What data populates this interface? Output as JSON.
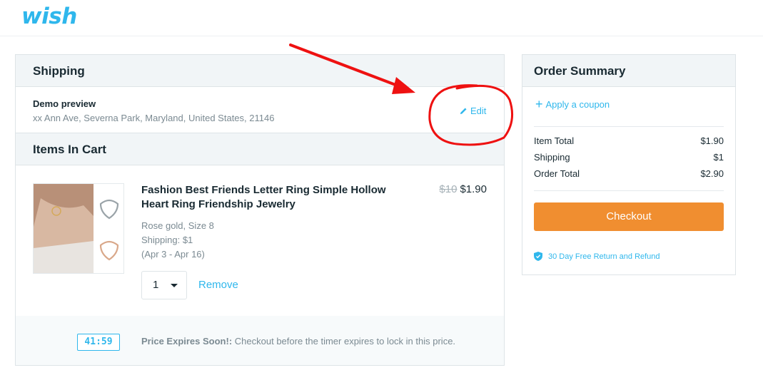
{
  "header": {
    "logo_text": "wish",
    "brand_color": "#2fb7ec"
  },
  "shipping": {
    "title": "Shipping",
    "name": "Demo preview",
    "address": "xx Ann Ave, Severna Park, Maryland, United States, 21146",
    "edit_label": "Edit",
    "edit_icon": "pencil-icon"
  },
  "cart": {
    "title": "Items In Cart",
    "item": {
      "title": "Fashion Best Friends Letter Ring Simple Hollow Heart Ring Friendship Jewelry",
      "old_price": "$10",
      "price": "$1.90",
      "variant": "Rose gold, Size 8",
      "shipping": "Shipping: $1",
      "delivery": "(Apr 3 - Apr 16)",
      "quantity": "1",
      "remove_label": "Remove"
    },
    "timer": {
      "value": "41:59",
      "label": "Price Expires Soon!:",
      "message": "Checkout before the timer expires to lock in this price."
    }
  },
  "summary": {
    "title": "Order Summary",
    "coupon_label": "Apply a coupon",
    "rows": [
      {
        "label": "Item Total",
        "value": "$1.90"
      },
      {
        "label": "Shipping",
        "value": "$1"
      },
      {
        "label": "Order Total",
        "value": "$2.90"
      }
    ],
    "checkout_label": "Checkout",
    "checkout_color": "#f08e30",
    "guarantee": "30 Day Free Return and Refund"
  },
  "annotation_color": "#ee1111"
}
